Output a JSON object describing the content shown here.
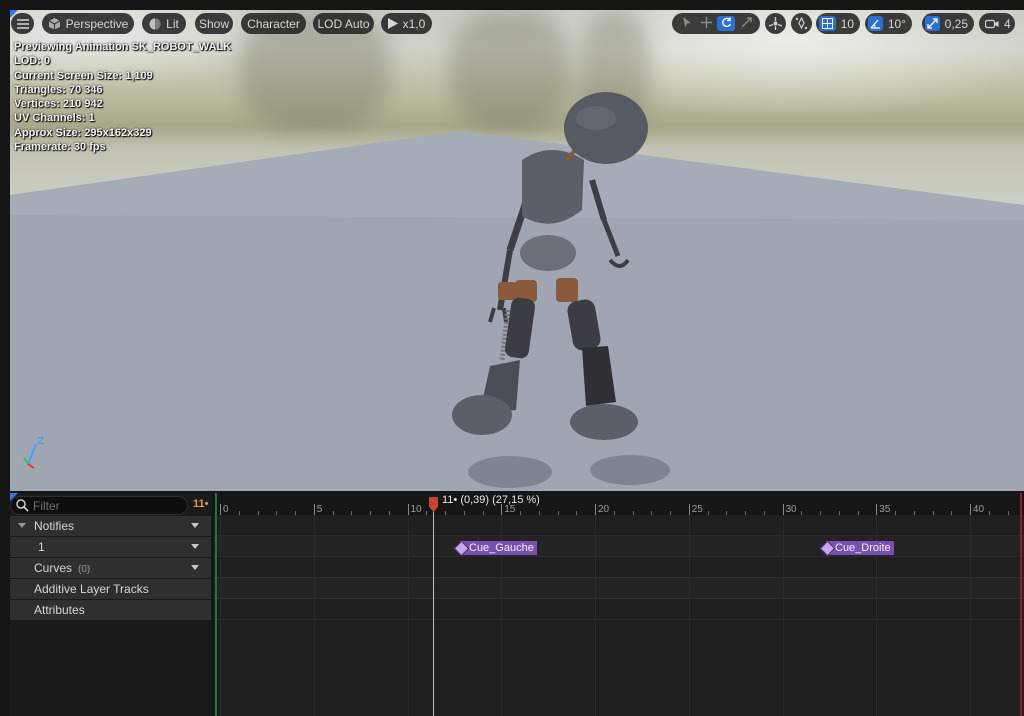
{
  "viewport": {
    "toolbar": {
      "perspective_label": "Perspective",
      "lit_label": "Lit",
      "show_label": "Show",
      "character_label": "Character",
      "lod_label": "LOD Auto",
      "play_rate_label": "x1,0",
      "grid_snap_value": "10",
      "rotation_snap_value": "10°",
      "scale_snap_value": "0,25",
      "camera_speed_value": "4"
    },
    "stats": [
      "Previewing Animation SK_ROBOT_WALK",
      "LOD: 0",
      "Current Screen Size: 1,109",
      "Triangles: 70 346",
      "Vertices: 210 942",
      "UV Channels: 1",
      "Approx Size: 295x162x329",
      "Framerate: 30 fps"
    ],
    "axis": {
      "z": "Z"
    }
  },
  "tracks": {
    "filter_placeholder": "Filter",
    "frame_count": "11•",
    "rows": {
      "notifies": "Notifies",
      "notify_track": "1",
      "curves": "Curves",
      "curves_count": "(0)",
      "additive": "Additive Layer Tracks",
      "attributes": "Attributes"
    }
  },
  "timeline": {
    "ticks": [
      "0",
      "5",
      "10",
      "15",
      "20",
      "25",
      "30",
      "35",
      "40"
    ],
    "playhead_label": "11• (0,39) (27,15 %)",
    "notifies": [
      "Cue_Gauche",
      "Cue_Droite"
    ]
  },
  "colors": {
    "accent": "#2a6fd6",
    "playhead": "#c7432c",
    "notify": "#7b4fb1",
    "frame_count": "#e89a36"
  }
}
